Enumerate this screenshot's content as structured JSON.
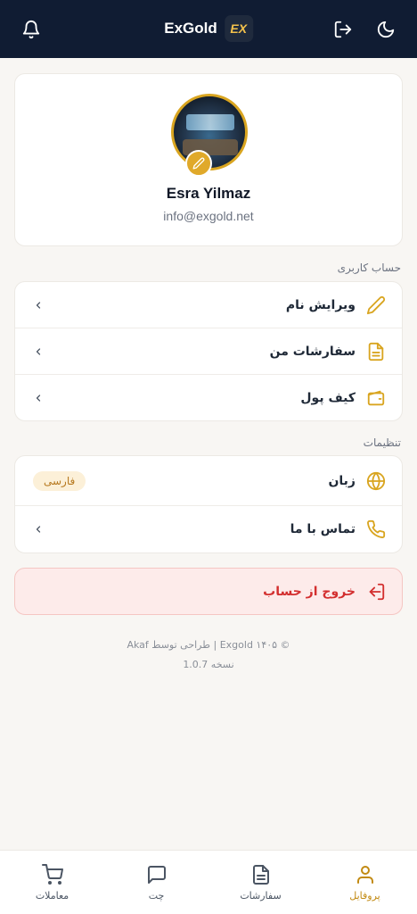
{
  "header": {
    "brand": "ExGold",
    "logo_text": "EX",
    "icons": [
      "bell-icon",
      "logout-icon",
      "moon-icon"
    ]
  },
  "profile": {
    "name": "Esra Yilmaz",
    "email": "info@exgold.net",
    "avatar_icon": "profile-photo",
    "edit_icon": "pencil-icon"
  },
  "account_section": {
    "title": "حساب کاربری",
    "items": [
      {
        "label": "ویرایش نام",
        "icon": "pencil-icon"
      },
      {
        "label": "سفارشات من",
        "icon": "document-icon"
      },
      {
        "label": "کیف پول",
        "icon": "wallet-icon"
      }
    ]
  },
  "settings_section": {
    "title": "تنظیمات",
    "language": {
      "label": "زبان",
      "value": "فارسی",
      "icon": "globe-icon"
    },
    "contact": {
      "label": "تماس با ما",
      "icon": "phone-icon"
    }
  },
  "logout": {
    "label": "خروج از حساب",
    "icon": "logout-icon"
  },
  "footer": {
    "credit": "© Exgold ۱۴۰۵ | طراحی توسط Akaf",
    "version": "نسخه 1.0.7"
  },
  "bottom_nav": [
    {
      "label": "معاملات",
      "icon": "cart-icon",
      "active": false
    },
    {
      "label": "چت",
      "icon": "chat-icon",
      "active": false
    },
    {
      "label": "سفارشات",
      "icon": "document-icon",
      "active": false
    },
    {
      "label": "پروفایل",
      "icon": "user-icon",
      "active": true
    }
  ],
  "colors": {
    "header_bg": "#101c33",
    "accent": "#e0a92a",
    "danger": "#d32f2f",
    "page_bg": "#f8f6f3"
  }
}
